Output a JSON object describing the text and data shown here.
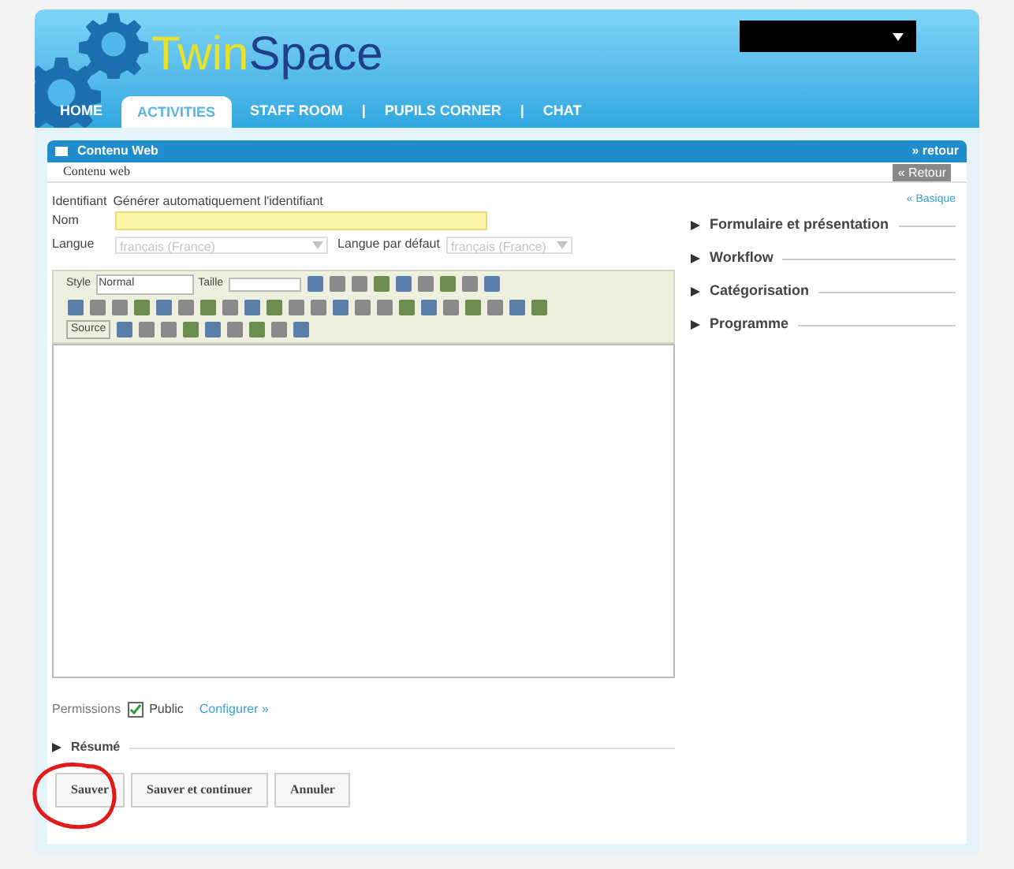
{
  "header": {
    "logo": {
      "part_1": "Twin",
      "part_2": "Space"
    },
    "nav": [
      {
        "kind": "tab",
        "label": "HOME",
        "selected": false
      },
      {
        "kind": "tab",
        "label": "ACTIVITIES",
        "selected": true
      },
      {
        "kind": "tab",
        "label": "STAFF ROOM",
        "selected": false
      },
      {
        "kind": "separator",
        "label": "|"
      },
      {
        "kind": "tab",
        "label": "PUPILS CORNER",
        "selected": false
      },
      {
        "kind": "separator",
        "label": "|"
      },
      {
        "kind": "tab",
        "label": "CHAT",
        "selected": false
      }
    ]
  },
  "panel": {
    "title": "Contenu Web",
    "back_link": "» retour",
    "subtitle": "Contenu web",
    "back_button": "« Retour"
  },
  "form": {
    "identifier_label": "Identifiant",
    "identifier_value": "Générer automatiquement l'identifiant",
    "name_label": "Nom",
    "language_label": "Langue",
    "language_value": "français (France)",
    "language_disabled": true,
    "default_language_label": "Langue par défaut",
    "default_language_value": "français (France)",
    "default_language_disabled": true
  },
  "editor": {
    "style_label": "Style",
    "style_value": "Normal",
    "size_label": "Taille",
    "source_label": "Source"
  },
  "sidebar": {
    "mode_link": "« Basique",
    "sections": [
      {
        "label": "Formulaire et présentation",
        "expanded": false
      },
      {
        "label": "Workflow",
        "expanded": false
      },
      {
        "label": "Catégorisation",
        "expanded": false
      },
      {
        "label": "Programme",
        "expanded": false
      }
    ]
  },
  "permissions": {
    "label": "Permissions",
    "public_label": "Public",
    "public_checked": true,
    "configure_link": "Configurer »"
  },
  "summary": {
    "label": "Résumé",
    "expanded": false
  },
  "buttons": [
    "Sauver",
    "Sauver et continuer",
    "Annuler"
  ],
  "annotation": {
    "kind": "circle"
  }
}
